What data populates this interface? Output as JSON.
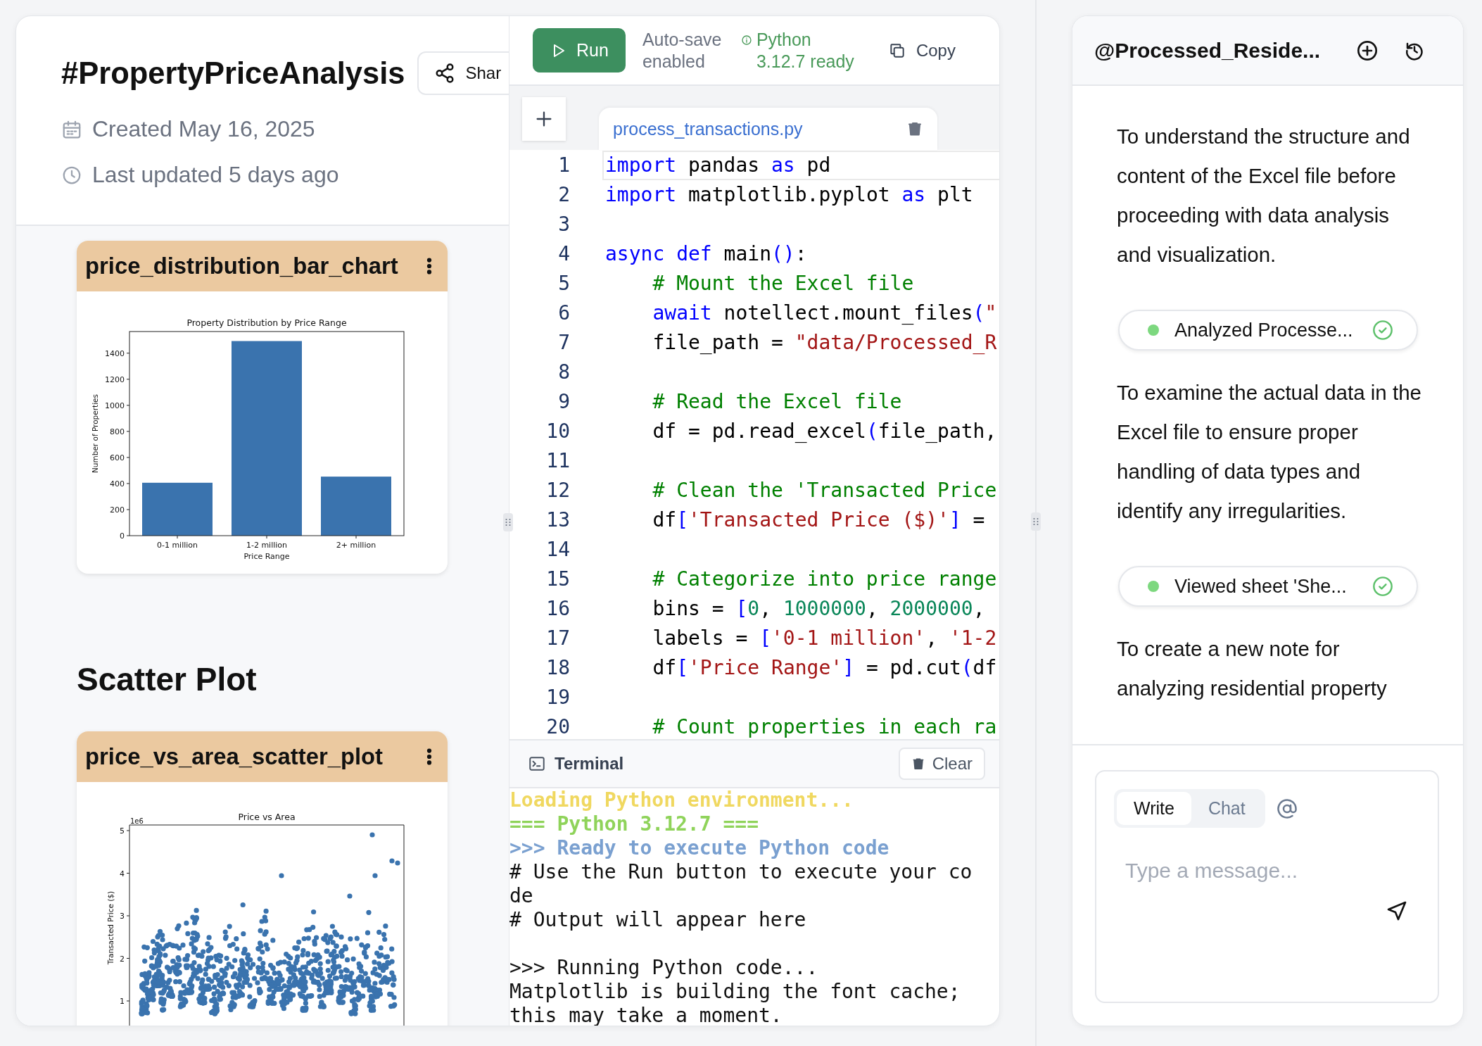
{
  "note": {
    "title": "#PropertyPriceAnalysis",
    "share_label": "Shar",
    "created": "Created May 16, 2025",
    "updated": "Last updated 5 days ago"
  },
  "cells": [
    {
      "kind": "chart",
      "title": "price_distribution_bar_chart",
      "chart_data": {
        "type": "bar",
        "title": "Property Distribution by Price Range",
        "xlabel": "Price Range",
        "ylabel": "Number of Properties",
        "categories": [
          "0-1 million",
          "1-2 million",
          "2+ million"
        ],
        "values": [
          406,
          1493,
          453
        ],
        "ylim": [
          0,
          1566
        ],
        "yticks": [
          0,
          200,
          400,
          600,
          800,
          1000,
          1200,
          1400
        ]
      }
    },
    {
      "kind": "heading",
      "text": "Scatter Plot"
    },
    {
      "kind": "picture",
      "title": "price_vs_area_scatter_plot",
      "plot": {
        "title": "Price vs Area",
        "ylabel": "Transacted Price ($)",
        "offset_label": "1e6",
        "yticks": [
          "5",
          "4",
          "3",
          "2",
          "1"
        ]
      }
    }
  ],
  "toolbar": {
    "run_label": "Run",
    "autosave": "Auto-save enabled",
    "runtime": "Python 3.12.7 ready",
    "copy_label": "Copy"
  },
  "editor": {
    "file_tab": "process_transactions.py",
    "lines": [
      {
        "number": "1",
        "current": true,
        "tokens": [
          {
            "kind": "keyword",
            "text": "import"
          },
          {
            "kind": "text",
            "text": " pandas "
          },
          {
            "kind": "keyword",
            "text": "as"
          },
          {
            "kind": "text",
            "text": " pd"
          }
        ]
      },
      {
        "number": "2",
        "current": false,
        "tokens": [
          {
            "kind": "keyword",
            "text": "import"
          },
          {
            "kind": "text",
            "text": " matplotlib.pyplot "
          },
          {
            "kind": "keyword",
            "text": "as"
          },
          {
            "kind": "text",
            "text": " plt"
          }
        ]
      },
      {
        "number": "3",
        "current": false
      },
      {
        "number": "4",
        "current": false,
        "tokens": [
          {
            "kind": "keyword",
            "text": "async def"
          },
          {
            "kind": "text",
            "text": " main"
          },
          {
            "kind": "bracket",
            "text": "()"
          },
          {
            "kind": "text",
            "text": ":"
          }
        ]
      },
      {
        "number": "5",
        "current": false,
        "tokens": [
          {
            "kind": "comment",
            "text": "    # Mount the Excel file"
          }
        ]
      },
      {
        "number": "6",
        "current": false,
        "tokens": [
          {
            "kind": "keyword",
            "text": "    await"
          },
          {
            "kind": "text",
            "text": " notellect.mount_files"
          },
          {
            "kind": "bracket",
            "text": "("
          },
          {
            "kind": "string",
            "text": "\""
          }
        ]
      },
      {
        "number": "7",
        "current": false,
        "tokens": [
          {
            "kind": "text",
            "text": "    file_path = "
          },
          {
            "kind": "string",
            "text": "\"data/Processed_R"
          }
        ]
      },
      {
        "number": "8",
        "current": false
      },
      {
        "number": "9",
        "current": false,
        "tokens": [
          {
            "kind": "comment",
            "text": "    # Read the Excel file"
          }
        ]
      },
      {
        "number": "10",
        "current": false,
        "tokens": [
          {
            "kind": "text",
            "text": "    df = pd.read_excel"
          },
          {
            "kind": "bracket",
            "text": "("
          },
          {
            "kind": "text",
            "text": "file_path,"
          }
        ]
      },
      {
        "number": "11",
        "current": false
      },
      {
        "number": "12",
        "current": false,
        "tokens": [
          {
            "kind": "comment",
            "text": "    # Clean the 'Transacted Price"
          }
        ]
      },
      {
        "number": "13",
        "current": false,
        "tokens": [
          {
            "kind": "text",
            "text": "    df"
          },
          {
            "kind": "bracket",
            "text": "["
          },
          {
            "kind": "string",
            "text": "'Transacted Price ($)'"
          },
          {
            "kind": "bracket",
            "text": "]"
          },
          {
            "kind": "text",
            "text": " ="
          }
        ]
      },
      {
        "number": "14",
        "current": false
      },
      {
        "number": "15",
        "current": false,
        "tokens": [
          {
            "kind": "comment",
            "text": "    # Categorize into price range"
          }
        ]
      },
      {
        "number": "16",
        "current": false,
        "tokens": [
          {
            "kind": "text",
            "text": "    bins = "
          },
          {
            "kind": "bracket",
            "text": "["
          },
          {
            "kind": "number",
            "text": "0"
          },
          {
            "kind": "text",
            "text": ", "
          },
          {
            "kind": "number",
            "text": "1000000"
          },
          {
            "kind": "text",
            "text": ", "
          },
          {
            "kind": "number",
            "text": "2000000"
          },
          {
            "kind": "text",
            "text": ","
          }
        ]
      },
      {
        "number": "17",
        "current": false,
        "tokens": [
          {
            "kind": "text",
            "text": "    labels = "
          },
          {
            "kind": "bracket",
            "text": "["
          },
          {
            "kind": "string",
            "text": "'0-1 million'"
          },
          {
            "kind": "text",
            "text": ", "
          },
          {
            "kind": "string",
            "text": "'1-2"
          }
        ]
      },
      {
        "number": "18",
        "current": false,
        "tokens": [
          {
            "kind": "text",
            "text": "    df"
          },
          {
            "kind": "bracket",
            "text": "["
          },
          {
            "kind": "string",
            "text": "'Price Range'"
          },
          {
            "kind": "bracket",
            "text": "]"
          },
          {
            "kind": "text",
            "text": " = pd.cut"
          },
          {
            "kind": "bracket",
            "text": "("
          },
          {
            "kind": "text",
            "text": "df"
          }
        ]
      },
      {
        "number": "19",
        "current": false
      },
      {
        "number": "20",
        "current": false,
        "tokens": [
          {
            "kind": "comment",
            "text": "    # Count properties in each ra"
          }
        ]
      }
    ]
  },
  "terminal": {
    "title": "Terminal",
    "clear_label": "Clear",
    "blocks": [
      {
        "lines": [
          {
            "kind": "info",
            "text": "Loading Python environment..."
          },
          {
            "kind": "version",
            "text": "=== Python 3.12.7 ==="
          },
          {
            "kind": "prompt",
            "text": ">>> Ready to execute Python code"
          },
          {
            "kind": "output",
            "text": "# Use the Run button to execute your code"
          },
          {
            "kind": "output",
            "text": "# Output will appear here"
          }
        ]
      },
      {
        "lines": [
          {
            "kind": "output",
            "text": ">>> Running Python code..."
          },
          {
            "kind": "output",
            "text": "Matplotlib is building the font cache;"
          },
          {
            "kind": "output",
            "text": "this may take a moment."
          }
        ]
      }
    ]
  },
  "assistant": {
    "title": "@Processed_Reside...",
    "messages": [
      {
        "kind": "text",
        "text": "To understand the structure and content of the Excel file before proceeding with data analysis and visualization."
      },
      {
        "kind": "step",
        "text": "Analyzed Processe...",
        "done": true
      },
      {
        "kind": "text",
        "text": "To examine the actual data in the Excel file to ensure proper handling of data types and identify any irregularities."
      },
      {
        "kind": "step",
        "text": "Viewed sheet 'She...",
        "done": true
      },
      {
        "kind": "text",
        "text": "To create a new note for analyzing residential property"
      }
    ],
    "composer": {
      "tabs": [
        {
          "label": "Write",
          "selected": true
        },
        {
          "label": "Chat",
          "selected": false
        }
      ],
      "placeholder": "Type a message..."
    }
  }
}
